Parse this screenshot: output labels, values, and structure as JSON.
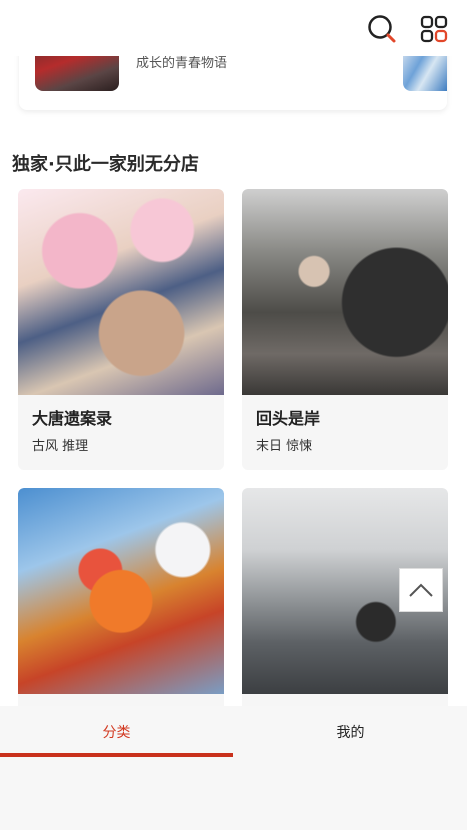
{
  "previous_card": {
    "description": "成长的青春物语"
  },
  "section": {
    "title": "独家·只此一家别无分店"
  },
  "comics": [
    {
      "title": "大唐遗案录",
      "tags": "古风 推理"
    },
    {
      "title": "回头是岸",
      "tags": "末日 惊悚"
    },
    {
      "title": "",
      "tags": ""
    },
    {
      "title": "",
      "tags": ""
    }
  ],
  "tabs": [
    {
      "label": "分类",
      "active": true
    },
    {
      "label": "我的",
      "active": false
    }
  ],
  "colors": {
    "accent": "#d23a22",
    "search_icon_accent": "#e2472a"
  },
  "icons": {
    "search": "search-icon",
    "apps": "grid-icon",
    "back_to_top": "chevron-up-icon"
  }
}
